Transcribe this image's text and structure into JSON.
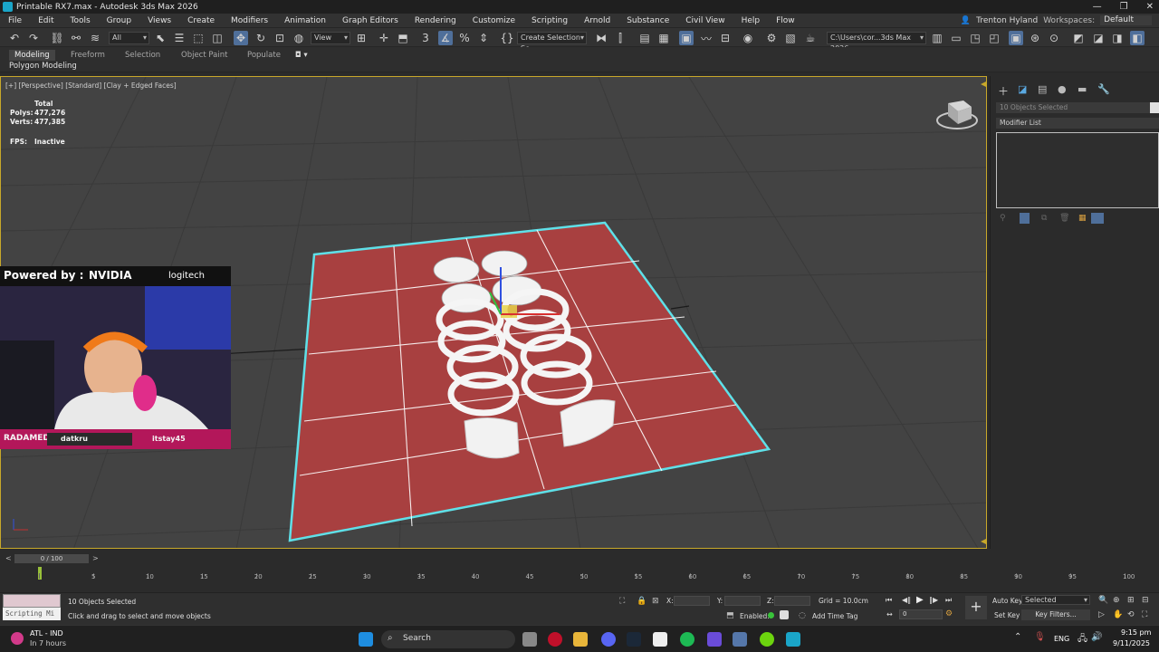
{
  "window": {
    "title": "Printable RX7.max - Autodesk 3ds Max 2026",
    "controls": [
      "—",
      "❐",
      "✕"
    ]
  },
  "menu": {
    "items": [
      "File",
      "Edit",
      "Tools",
      "Group",
      "Views",
      "Create",
      "Modifiers",
      "Animation",
      "Graph Editors",
      "Rendering",
      "Customize",
      "Scripting",
      "Arnold",
      "Substance",
      "Civil View",
      "Help",
      "Flow"
    ],
    "user": "Trenton Hyland",
    "workspaces_label": "Workspaces:",
    "workspace_value": "Default"
  },
  "toolbar": {
    "filter_value": "All",
    "view_value": "View",
    "selection_set": "Create Selection Se",
    "path_value": "C:\\Users\\cor...3ds Max 2026"
  },
  "ribbon": {
    "tabs": [
      "Modeling",
      "Freeform",
      "Selection",
      "Object Paint",
      "Populate"
    ],
    "active_tab": "Modeling",
    "subpanel": "Polygon Modeling"
  },
  "viewport": {
    "label": "[+] [Perspective] [Standard] [Clay + Edged Faces]",
    "stats_total": "Total",
    "polys_label": "Polys:",
    "polys_value": "477,276",
    "verts_label": "Verts:",
    "verts_value": "477,385",
    "fps_label": "FPS:",
    "fps_value": "Inactive"
  },
  "command_panel": {
    "objects_selected": "10 Objects Selected",
    "modifier_list": "Modifier List"
  },
  "overlay": {
    "powered_by": "Powered by :",
    "sponsor1": "NVIDIA",
    "sponsor2": "logitech",
    "brand": "RADAMEDIA",
    "user1": "datkru",
    "user2": "itstay45"
  },
  "timeline": {
    "frame_display": "0 / 100",
    "ticks": [
      "0",
      "5",
      "10",
      "15",
      "20",
      "25",
      "30",
      "35",
      "40",
      "45",
      "50",
      "55",
      "60",
      "65",
      "70",
      "75",
      "80",
      "85",
      "90",
      "95",
      "100"
    ]
  },
  "status": {
    "maxscript": "Scripting Mi",
    "selected": "10 Objects Selected",
    "prompt": "Click and drag to select and move objects",
    "x_label": "X:",
    "y_label": "Y:",
    "z_label": "Z:",
    "grid": "Grid = 10.0cm",
    "enabled": "Enabled:",
    "add_time_tag": "Add Time Tag",
    "auto_key": "Auto Key",
    "set_key": "Set Key",
    "key_dropdown": "Selected",
    "key_filters": "Key Filters...",
    "frame_value": "0"
  },
  "taskbar": {
    "weather_temp": "ATL - IND",
    "weather_sub": "In 7 hours",
    "search": "Search",
    "lang": "ENG",
    "time": "9:15 pm",
    "date": "9/11/2025"
  },
  "colors": {
    "accent": "#4f6f9a",
    "viewport_bg": "#434343",
    "plane": "#a84040",
    "selection": "#5fe0e8",
    "viewport_border": "#c8a82a",
    "overlay_pink": "#b3175a"
  }
}
